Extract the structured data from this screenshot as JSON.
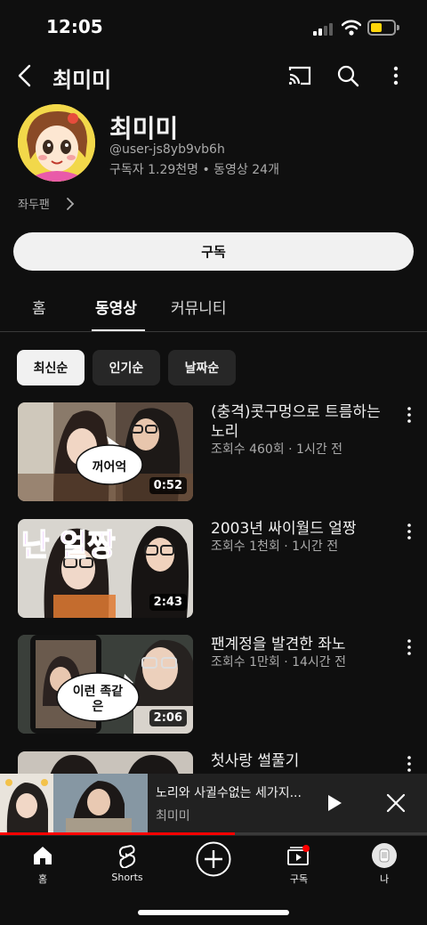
{
  "status_bar": {
    "time": "12:05"
  },
  "top_bar": {
    "title": "최미미"
  },
  "channel": {
    "name": "최미미",
    "handle": "@user-js8yb9vb6h",
    "stats": "구독자 1.29천명 • 동영상 24개",
    "link_label": "좌두팬"
  },
  "subscribe_label": "구독",
  "tabs": [
    {
      "label": "홈"
    },
    {
      "label": "동영상",
      "active": true
    },
    {
      "label": "커뮤니티"
    }
  ],
  "chips": [
    {
      "label": "최신순",
      "active": true
    },
    {
      "label": "인기순"
    },
    {
      "label": "날짜순"
    }
  ],
  "videos": [
    {
      "title": "(충격)콧구멍으로 트름하는 노리",
      "meta": "조회수 460회 · 1시간 전",
      "duration": "0:52",
      "overlay": "꺼어억"
    },
    {
      "title": "2003년 싸이월드 얼짱",
      "meta": "조회수 1천회 · 1시간 전",
      "duration": "2:43",
      "overlay": "난 얼짱"
    },
    {
      "title": "팬계정을 발견한 좌노",
      "meta": "조회수 1만회 · 14시간 전",
      "duration": "2:06",
      "overlay": "이런 족같은"
    },
    {
      "title": "첫사랑 썰풀기",
      "meta": "",
      "duration": "",
      "overlay": ""
    }
  ],
  "mini_player": {
    "title": "노리와 사귈수없는 세가지...",
    "channel": "최미미",
    "progress": 0.55
  },
  "bottom_nav": [
    {
      "label": "홈",
      "icon": "home-icon"
    },
    {
      "label": "Shorts",
      "icon": "shorts-icon"
    },
    {
      "label": "",
      "icon": "create-icon"
    },
    {
      "label": "구독",
      "icon": "subscriptions-icon"
    },
    {
      "label": "나",
      "icon": "profile-avatar"
    }
  ],
  "colors": {
    "accent": "#ff0000",
    "background": "#0f0f0f",
    "chip_active": "#f1f1f1",
    "battery": "#ffd60a"
  }
}
